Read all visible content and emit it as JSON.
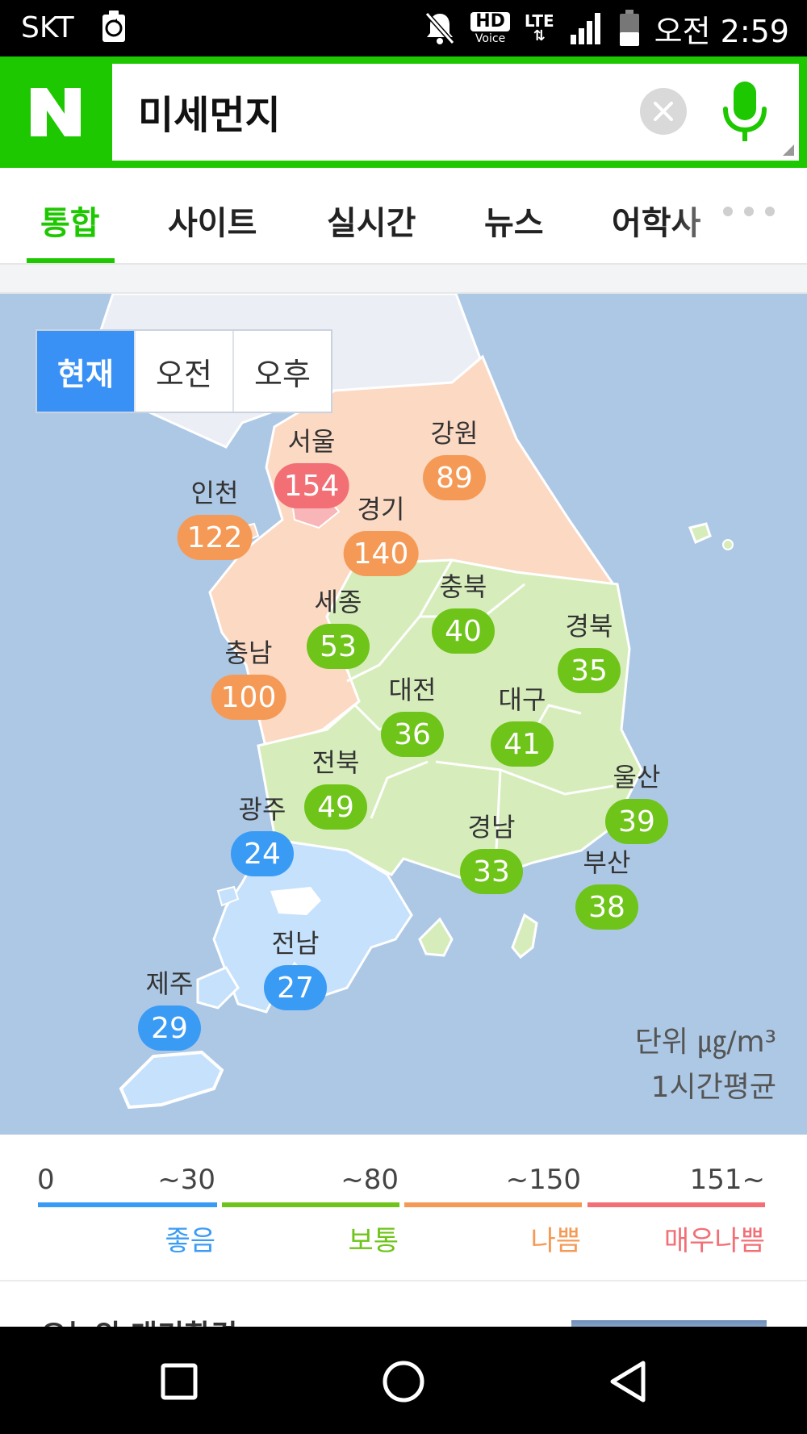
{
  "status_bar": {
    "carrier": "SKT",
    "hd_label": "HD",
    "voice_label": "Voice",
    "network_label": "LTE",
    "time": "오전 2:59",
    "icons": [
      "recycle-icon",
      "mute-icon",
      "signal-icon",
      "battery-icon"
    ]
  },
  "search": {
    "value": "미세먼지",
    "logo_text": "N",
    "brand_color": "#1ec800"
  },
  "tabs": [
    {
      "label": "통합",
      "active": true
    },
    {
      "label": "사이트",
      "active": false
    },
    {
      "label": "실시간",
      "active": false
    },
    {
      "label": "뉴스",
      "active": false
    },
    {
      "label": "어학사",
      "active": false
    }
  ],
  "map": {
    "time_toggle": [
      {
        "label": "현재",
        "active": true
      },
      {
        "label": "오전",
        "active": false
      },
      {
        "label": "오후",
        "active": false
      }
    ],
    "regions": [
      {
        "name": "서울",
        "value": "154",
        "level": "verybad"
      },
      {
        "name": "강원",
        "value": "89",
        "level": "bad"
      },
      {
        "name": "인천",
        "value": "122",
        "level": "bad"
      },
      {
        "name": "경기",
        "value": "140",
        "level": "bad"
      },
      {
        "name": "충북",
        "value": "40",
        "level": "normal"
      },
      {
        "name": "세종",
        "value": "53",
        "level": "normal"
      },
      {
        "name": "경북",
        "value": "35",
        "level": "normal"
      },
      {
        "name": "충남",
        "value": "100",
        "level": "bad"
      },
      {
        "name": "대전",
        "value": "36",
        "level": "normal"
      },
      {
        "name": "대구",
        "value": "41",
        "level": "normal"
      },
      {
        "name": "전북",
        "value": "49",
        "level": "normal"
      },
      {
        "name": "울산",
        "value": "39",
        "level": "normal"
      },
      {
        "name": "광주",
        "value": "24",
        "level": "good"
      },
      {
        "name": "경남",
        "value": "33",
        "level": "normal"
      },
      {
        "name": "부산",
        "value": "38",
        "level": "normal"
      },
      {
        "name": "전남",
        "value": "27",
        "level": "good"
      },
      {
        "name": "제주",
        "value": "29",
        "level": "good"
      }
    ],
    "unit_line1": "단위 ㎍/m³",
    "unit_line2": "1시간평균"
  },
  "legend": {
    "start": "0",
    "levels": [
      {
        "range": "~30",
        "label": "좋음",
        "color": "#3a9bf5"
      },
      {
        "range": "~80",
        "label": "보통",
        "color": "#6fc419"
      },
      {
        "range": "~150",
        "label": "나쁨",
        "color": "#f59a56"
      },
      {
        "range": "151~",
        "label": "매우나쁨",
        "color": "#f26f76"
      }
    ]
  },
  "next_section": {
    "title": "오늘의 대기환경"
  },
  "nav": {
    "icons": [
      "recent-apps-icon",
      "home-icon",
      "back-icon"
    ]
  }
}
